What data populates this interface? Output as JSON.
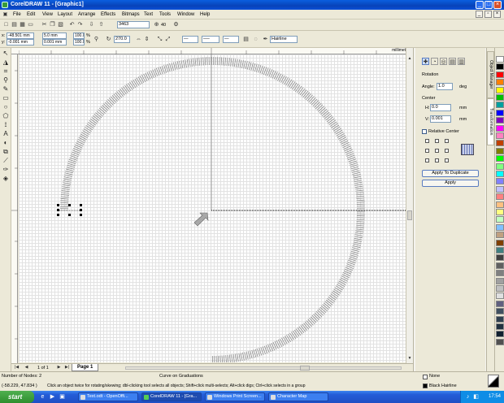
{
  "window": {
    "title": "CorelDRAW 11 - [Graphic1]"
  },
  "menu": [
    "File",
    "Edit",
    "View",
    "Layout",
    "Arrange",
    "Effects",
    "Bitmaps",
    "Text",
    "Tools",
    "Window",
    "Help"
  ],
  "standard_toolbar": {
    "zoom_value": "3463",
    "zoom_extra": "40"
  },
  "property_bar": {
    "x": "-48.501 mm",
    "y": "-0.001 mm",
    "width": "5.0 mm",
    "height": "0.001 mm",
    "scale_w": "100.0",
    "scale_h": "100.0",
    "scale_unit": "%",
    "angle": "270.0",
    "outline_width": "Hairline"
  },
  "ruler": {
    "unit": "millimeters"
  },
  "docker": {
    "rotation_label": "Rotation",
    "angle_label": "Angle:",
    "angle_value": "1.0",
    "angle_unit": "deg",
    "center_label": "Center",
    "h_label": "H:",
    "h_value": "0.0",
    "h_unit": "mm",
    "v_label": "V:",
    "v_value": "0.001",
    "v_unit": "mm",
    "relative_center_label": "Relative Center",
    "apply_duplicate_label": "Apply To Duplicate",
    "apply_label": "Apply",
    "tabs": [
      "Object Manager",
      "Transformation"
    ]
  },
  "page_nav": {
    "page_count": "1 of 1",
    "page_tab": "Page 1"
  },
  "palette_colors": [
    "#ffffff",
    "#000000",
    "#ff0000",
    "#ff8000",
    "#ffff00",
    "#00c000",
    "#00a0a0",
    "#0000ff",
    "#8000c0",
    "#ff00ff",
    "#ff80c0",
    "#c04000",
    "#808000",
    "#00ff00",
    "#80ff80",
    "#00ffff",
    "#8080ff",
    "#c0c0ff",
    "#ff8080",
    "#ffc080",
    "#ffff80",
    "#c0ffc0",
    "#80c0ff",
    "#c0a080",
    "#804000",
    "#408080",
    "#404040",
    "#606060",
    "#808080",
    "#a0a0a0",
    "#c0c0c0",
    "#e0e0e0",
    "#606080",
    "#405060",
    "#304050",
    "#203040",
    "#102030",
    "#505050"
  ],
  "status": {
    "nodes": "Number of Nodes: 2",
    "coords": "(-58.229, 47.834 )",
    "object_info": "Curve on Graduations",
    "hint": "Click an object twice for rotating/skewing; dbl-clicking tool selects all objects; Shift+click multi-selects; Alt+click digs; Ctrl+click selects in a group",
    "fill": "None",
    "outline": "Black  Hairline"
  },
  "taskbar": {
    "start_label": "start",
    "tasks": [
      "Text.odt - OpenOffi...",
      "CorelDRAW 11 - [Gra...",
      "Windows Print Screen...",
      "Character Map"
    ],
    "clock": "17:54"
  }
}
